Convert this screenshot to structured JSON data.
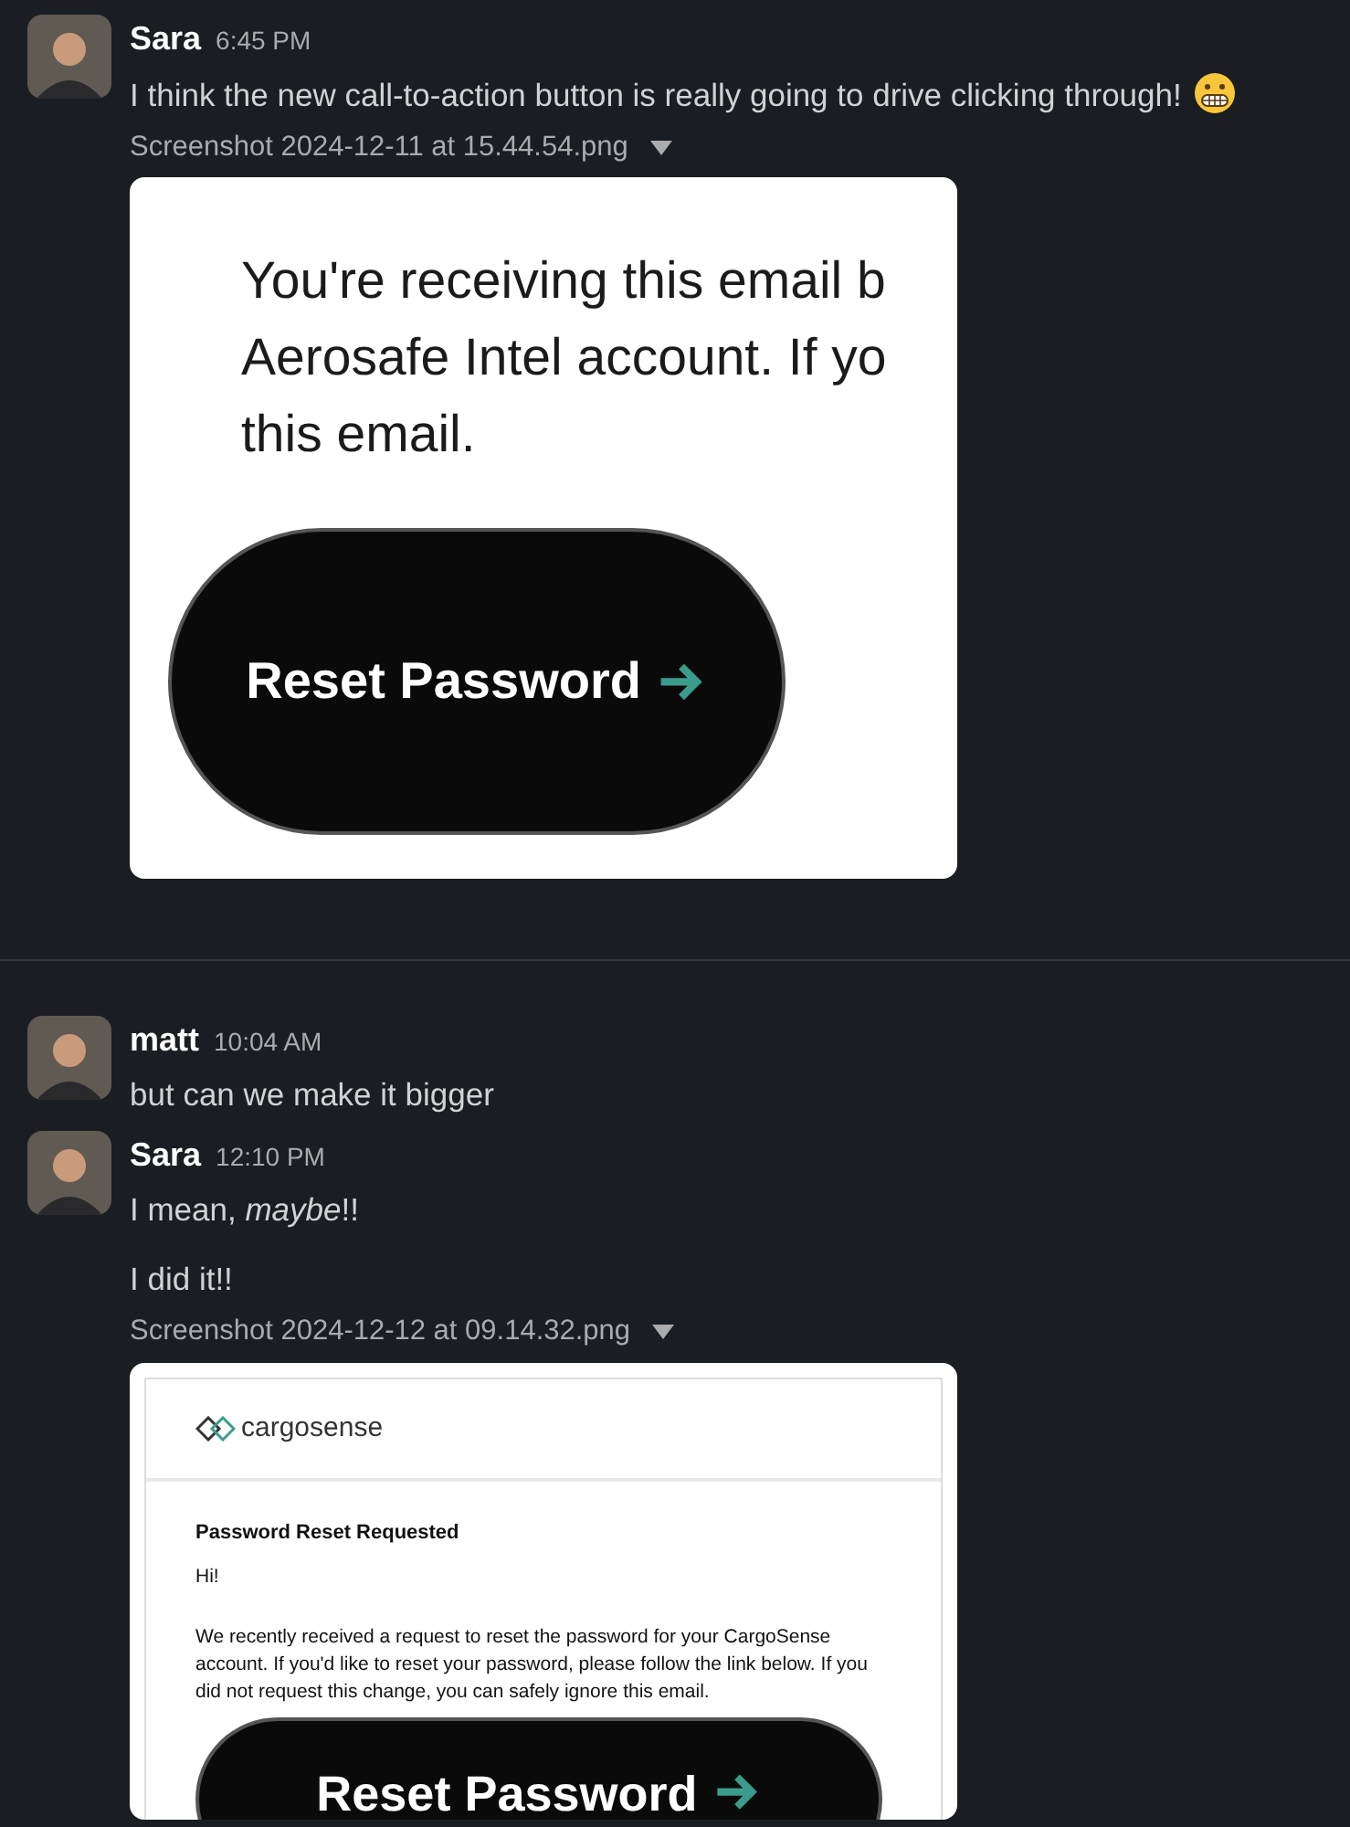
{
  "messages": [
    {
      "author": "Sara",
      "time": "6:45 PM",
      "divider_before": false,
      "texts": [
        "I think the new call-to-action button is really going to drive clicking through!"
      ],
      "emoji": true,
      "attachment": {
        "filename": "Screenshot 2024-12-11 at 15.44.54.png",
        "kind": "snippet",
        "lines": [
          "You're receiving this email b",
          "Aerosafe Intel account. If yo",
          "this email."
        ],
        "button": "Reset Password"
      }
    },
    {
      "author": "matt",
      "time": "10:04 AM",
      "divider_before": true,
      "texts": [
        "but can we make it bigger"
      ]
    },
    {
      "author": "Sara",
      "time": "12:10 PM",
      "divider_before": false,
      "texts": [
        "I mean, *maybe*!!",
        "I did it!!"
      ],
      "attachment": {
        "filename": "Screenshot 2024-12-12 at 09.14.32.png",
        "kind": "email",
        "logo": "cargosense",
        "heading": "Password Reset Requested",
        "greeting": "Hi!",
        "body": "We recently received a request to reset the password for your CargoSense account. If you'd like to reset your password, please follow the link below. If you did not request this change, you can safely ignore this email.",
        "button": "Reset Password"
      }
    }
  ]
}
